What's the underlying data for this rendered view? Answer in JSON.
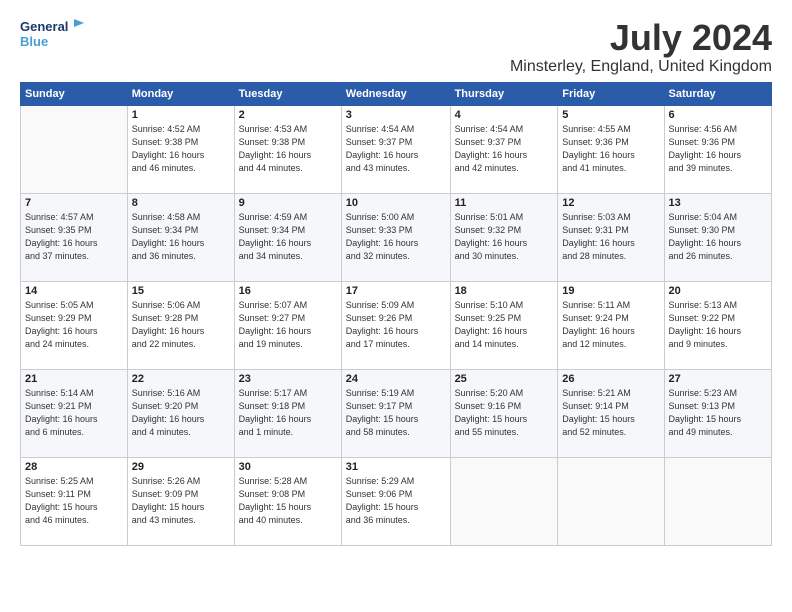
{
  "logo": {
    "line1": "General",
    "line2": "Blue",
    "icon_color": "#4a9fd4"
  },
  "title": "July 2024",
  "location": "Minsterley, England, United Kingdom",
  "weekdays": [
    "Sunday",
    "Monday",
    "Tuesday",
    "Wednesday",
    "Thursday",
    "Friday",
    "Saturday"
  ],
  "weeks": [
    [
      {
        "day": "",
        "detail": ""
      },
      {
        "day": "1",
        "detail": "Sunrise: 4:52 AM\nSunset: 9:38 PM\nDaylight: 16 hours\nand 46 minutes."
      },
      {
        "day": "2",
        "detail": "Sunrise: 4:53 AM\nSunset: 9:38 PM\nDaylight: 16 hours\nand 44 minutes."
      },
      {
        "day": "3",
        "detail": "Sunrise: 4:54 AM\nSunset: 9:37 PM\nDaylight: 16 hours\nand 43 minutes."
      },
      {
        "day": "4",
        "detail": "Sunrise: 4:54 AM\nSunset: 9:37 PM\nDaylight: 16 hours\nand 42 minutes."
      },
      {
        "day": "5",
        "detail": "Sunrise: 4:55 AM\nSunset: 9:36 PM\nDaylight: 16 hours\nand 41 minutes."
      },
      {
        "day": "6",
        "detail": "Sunrise: 4:56 AM\nSunset: 9:36 PM\nDaylight: 16 hours\nand 39 minutes."
      }
    ],
    [
      {
        "day": "7",
        "detail": "Sunrise: 4:57 AM\nSunset: 9:35 PM\nDaylight: 16 hours\nand 37 minutes."
      },
      {
        "day": "8",
        "detail": "Sunrise: 4:58 AM\nSunset: 9:34 PM\nDaylight: 16 hours\nand 36 minutes."
      },
      {
        "day": "9",
        "detail": "Sunrise: 4:59 AM\nSunset: 9:34 PM\nDaylight: 16 hours\nand 34 minutes."
      },
      {
        "day": "10",
        "detail": "Sunrise: 5:00 AM\nSunset: 9:33 PM\nDaylight: 16 hours\nand 32 minutes."
      },
      {
        "day": "11",
        "detail": "Sunrise: 5:01 AM\nSunset: 9:32 PM\nDaylight: 16 hours\nand 30 minutes."
      },
      {
        "day": "12",
        "detail": "Sunrise: 5:03 AM\nSunset: 9:31 PM\nDaylight: 16 hours\nand 28 minutes."
      },
      {
        "day": "13",
        "detail": "Sunrise: 5:04 AM\nSunset: 9:30 PM\nDaylight: 16 hours\nand 26 minutes."
      }
    ],
    [
      {
        "day": "14",
        "detail": "Sunrise: 5:05 AM\nSunset: 9:29 PM\nDaylight: 16 hours\nand 24 minutes."
      },
      {
        "day": "15",
        "detail": "Sunrise: 5:06 AM\nSunset: 9:28 PM\nDaylight: 16 hours\nand 22 minutes."
      },
      {
        "day": "16",
        "detail": "Sunrise: 5:07 AM\nSunset: 9:27 PM\nDaylight: 16 hours\nand 19 minutes."
      },
      {
        "day": "17",
        "detail": "Sunrise: 5:09 AM\nSunset: 9:26 PM\nDaylight: 16 hours\nand 17 minutes."
      },
      {
        "day": "18",
        "detail": "Sunrise: 5:10 AM\nSunset: 9:25 PM\nDaylight: 16 hours\nand 14 minutes."
      },
      {
        "day": "19",
        "detail": "Sunrise: 5:11 AM\nSunset: 9:24 PM\nDaylight: 16 hours\nand 12 minutes."
      },
      {
        "day": "20",
        "detail": "Sunrise: 5:13 AM\nSunset: 9:22 PM\nDaylight: 16 hours\nand 9 minutes."
      }
    ],
    [
      {
        "day": "21",
        "detail": "Sunrise: 5:14 AM\nSunset: 9:21 PM\nDaylight: 16 hours\nand 6 minutes."
      },
      {
        "day": "22",
        "detail": "Sunrise: 5:16 AM\nSunset: 9:20 PM\nDaylight: 16 hours\nand 4 minutes."
      },
      {
        "day": "23",
        "detail": "Sunrise: 5:17 AM\nSunset: 9:18 PM\nDaylight: 16 hours\nand 1 minute."
      },
      {
        "day": "24",
        "detail": "Sunrise: 5:19 AM\nSunset: 9:17 PM\nDaylight: 15 hours\nand 58 minutes."
      },
      {
        "day": "25",
        "detail": "Sunrise: 5:20 AM\nSunset: 9:16 PM\nDaylight: 15 hours\nand 55 minutes."
      },
      {
        "day": "26",
        "detail": "Sunrise: 5:21 AM\nSunset: 9:14 PM\nDaylight: 15 hours\nand 52 minutes."
      },
      {
        "day": "27",
        "detail": "Sunrise: 5:23 AM\nSunset: 9:13 PM\nDaylight: 15 hours\nand 49 minutes."
      }
    ],
    [
      {
        "day": "28",
        "detail": "Sunrise: 5:25 AM\nSunset: 9:11 PM\nDaylight: 15 hours\nand 46 minutes."
      },
      {
        "day": "29",
        "detail": "Sunrise: 5:26 AM\nSunset: 9:09 PM\nDaylight: 15 hours\nand 43 minutes."
      },
      {
        "day": "30",
        "detail": "Sunrise: 5:28 AM\nSunset: 9:08 PM\nDaylight: 15 hours\nand 40 minutes."
      },
      {
        "day": "31",
        "detail": "Sunrise: 5:29 AM\nSunset: 9:06 PM\nDaylight: 15 hours\nand 36 minutes."
      },
      {
        "day": "",
        "detail": ""
      },
      {
        "day": "",
        "detail": ""
      },
      {
        "day": "",
        "detail": ""
      }
    ]
  ]
}
